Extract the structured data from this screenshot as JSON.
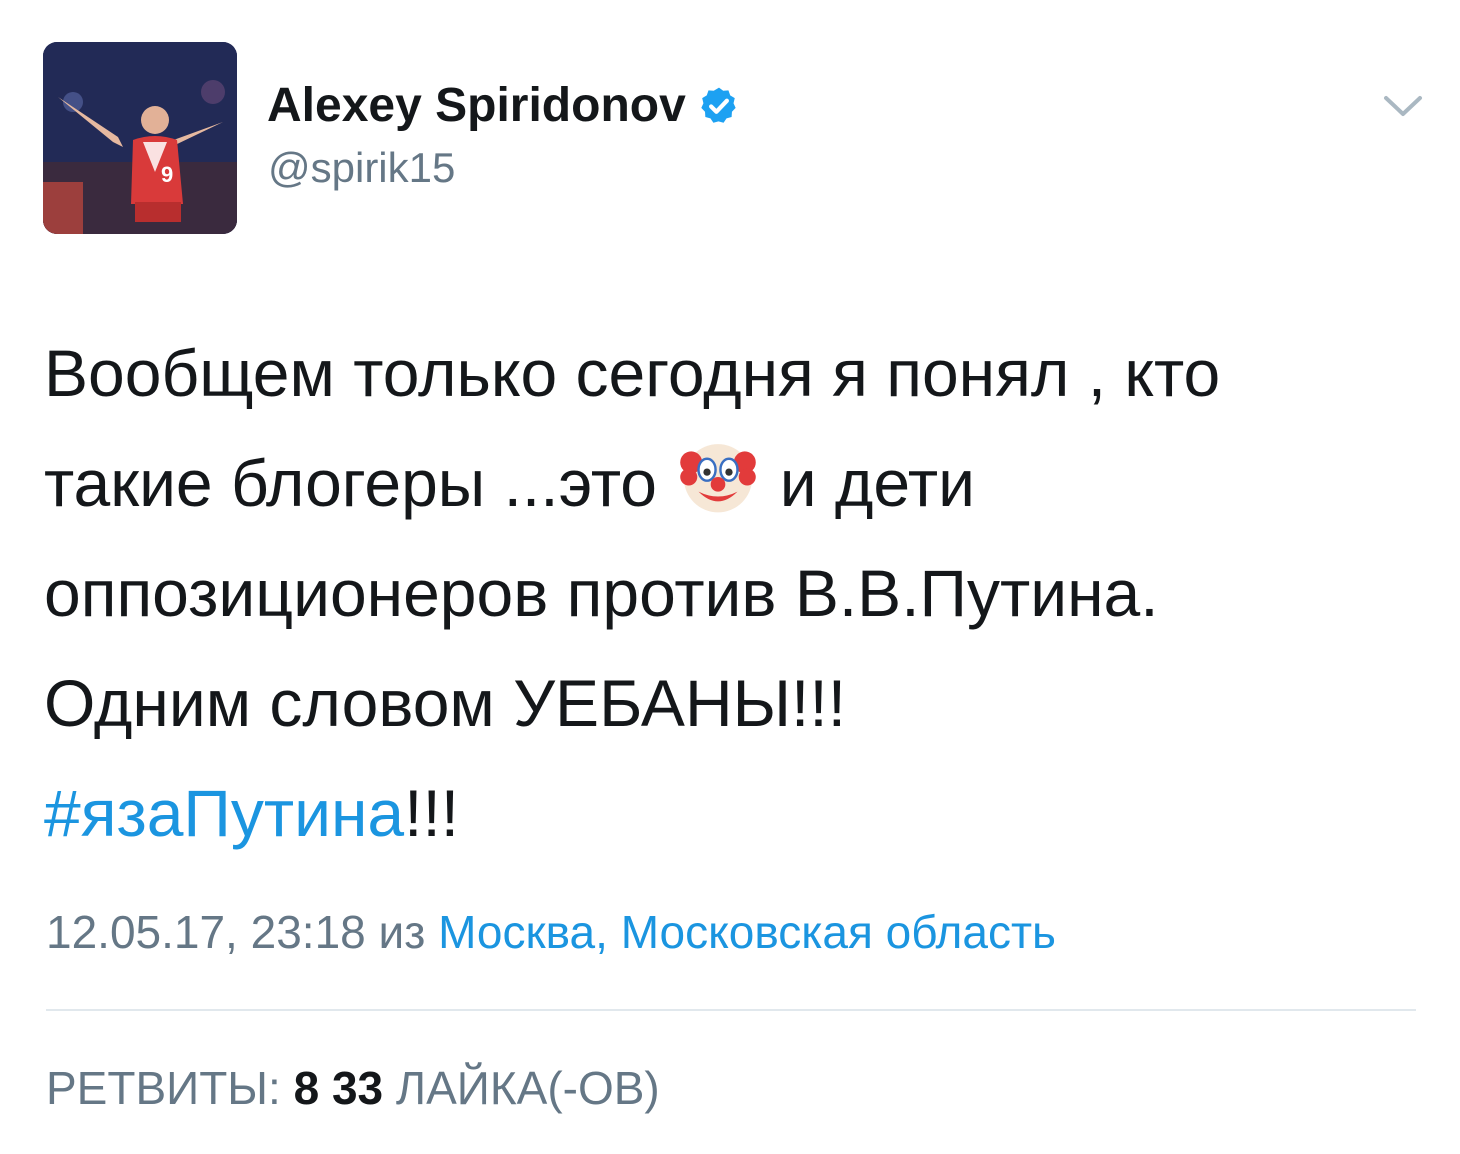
{
  "author": {
    "name": "Alexey Spiridonov",
    "handle": "@spirik15",
    "verified": true
  },
  "tweet": {
    "lines": [
      "Вообщем только сегодня я понял , кто",
      "такие блогеры ...это",
      "и дети",
      "оппозиционеров против В.В.Путина.",
      "Одним словом УЕБАНЫ!!!"
    ],
    "hashtag": "#язаПутина",
    "hashtag_suffix": "!!!",
    "emoji": "clown-face"
  },
  "meta": {
    "timestamp": "12.05.17, 23:18",
    "from_word": "из",
    "location": "Москва, Московская область"
  },
  "stats": {
    "retweets_label": "РЕТВИТЫ:",
    "retweets_count": "8",
    "likes_count": "33",
    "likes_label": "ЛАЙКА(-ОВ)"
  },
  "colors": {
    "link": "#1b95e0",
    "secondary_text": "#657786",
    "primary_text": "#14171a",
    "verified_badge": "#1da1f2"
  }
}
